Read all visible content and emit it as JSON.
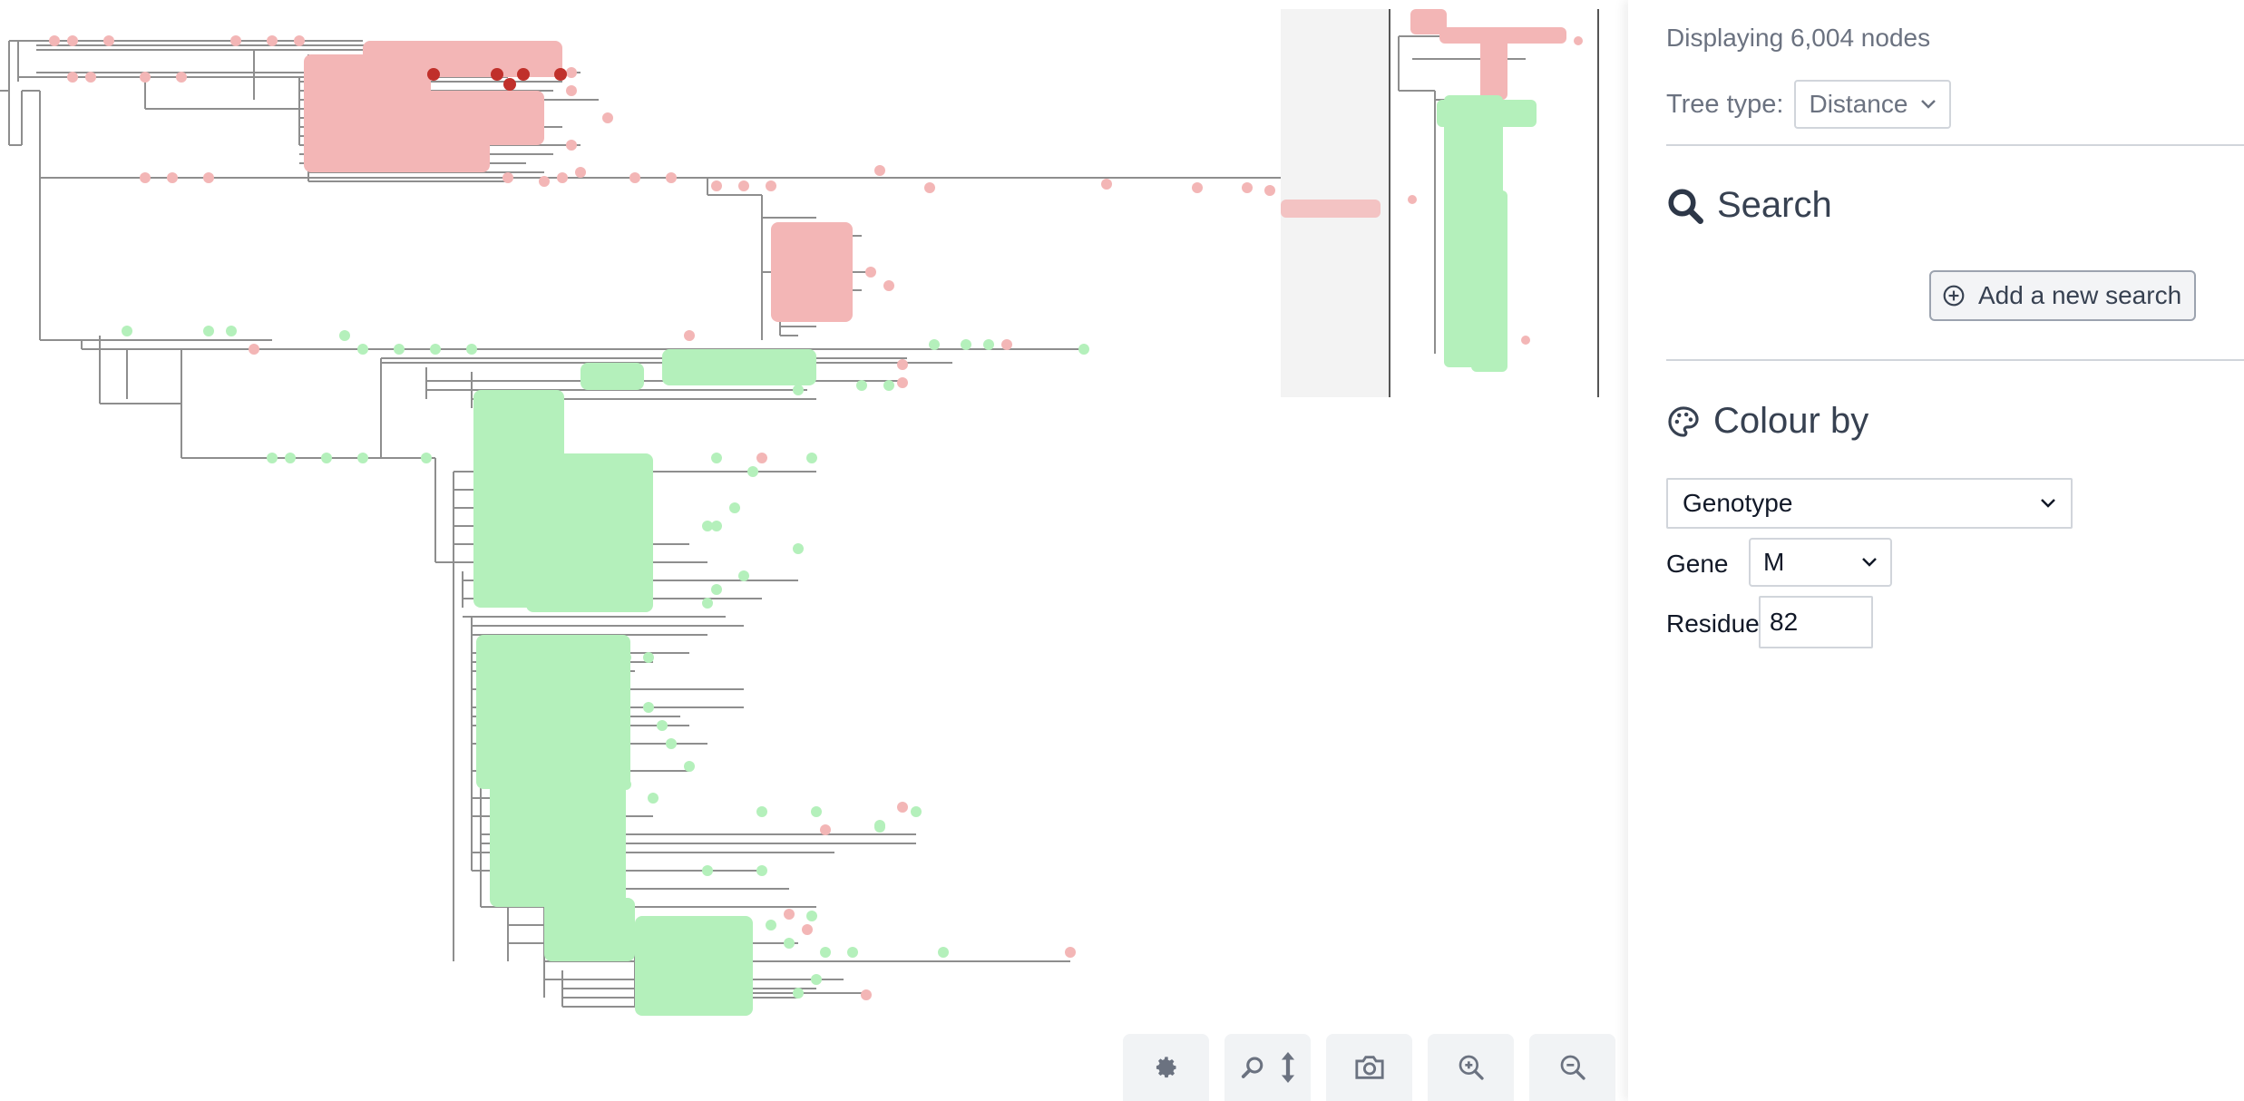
{
  "side_panel": {
    "node_count": "Displaying 6,004 nodes",
    "tree_type_label": "Tree type:",
    "tree_type_value": "Distance",
    "search_heading": "Search",
    "add_search_label": "Add a new search",
    "colour_heading": "Colour by",
    "colour_by_value": "Genotype",
    "gene_label": "Gene",
    "gene_value": "M",
    "residue_label": "Residue",
    "residue_value": "82"
  },
  "toolbar": {
    "buttons": [
      "settings",
      "search-zoom-vertical",
      "screenshot",
      "zoom-in",
      "zoom-out"
    ]
  },
  "colors": {
    "branch": "#8e8e8e",
    "clade_pink": "#f3b6b6",
    "clade_green": "#b4f0bb",
    "highlight_red": "#c0302b",
    "icon_dark": "#374151",
    "icon_gray": "#6b7280"
  }
}
